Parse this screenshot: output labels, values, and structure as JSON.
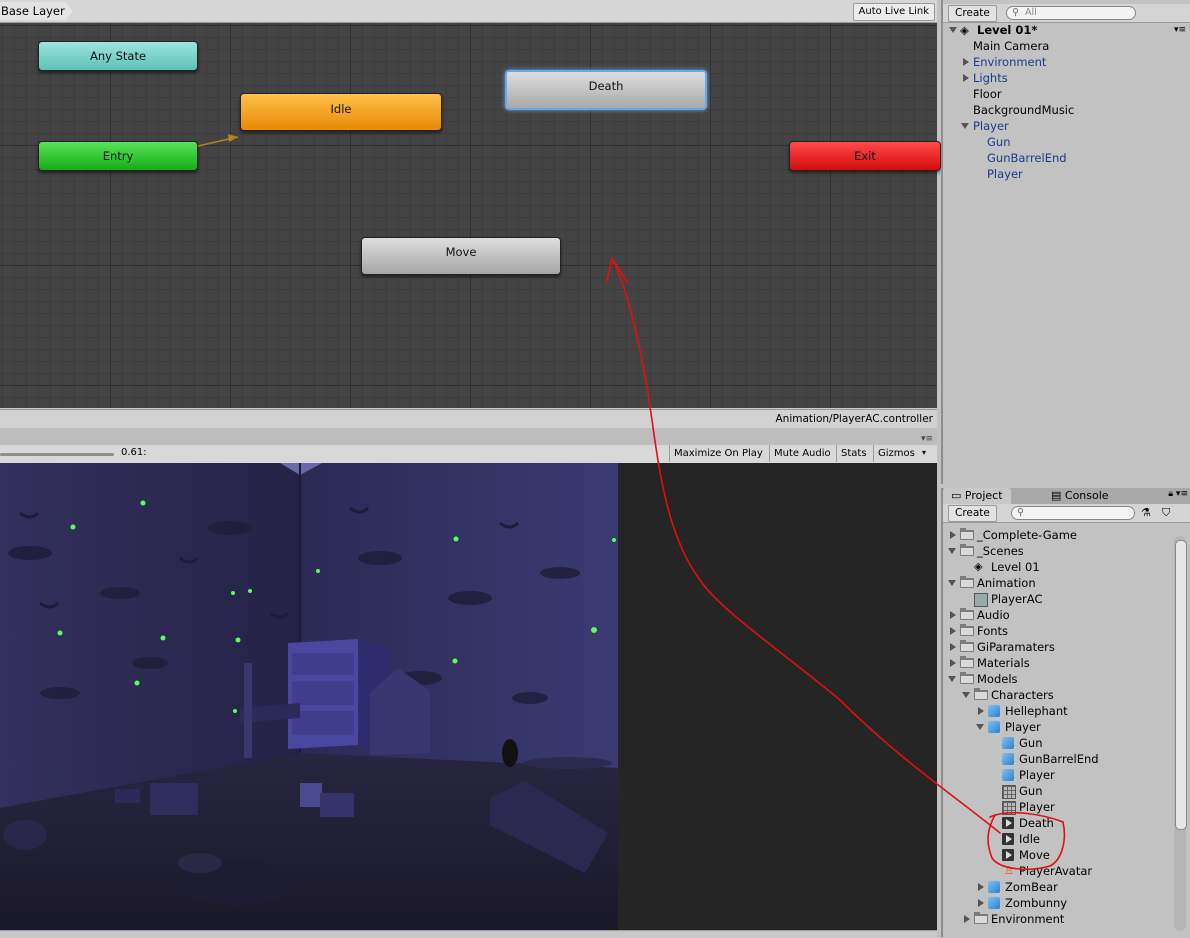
{
  "animator": {
    "breadcrumb": "Base Layer",
    "auto_live_link": "Auto Live Link",
    "controller_path": "Animation/PlayerAC.controller",
    "states": {
      "any_state": "Any State",
      "idle": "Idle",
      "death": "Death",
      "entry": "Entry",
      "exit": "Exit",
      "move": "Move"
    }
  },
  "game_view": {
    "scale_value": "0.61:",
    "maximize_on_play": "Maximize On Play",
    "mute_audio": "Mute Audio",
    "stats": "Stats",
    "gizmos": "Gizmos"
  },
  "hierarchy": {
    "create_label": "Create",
    "search_placeholder": "All",
    "scene_name": "Level 01*",
    "items": [
      {
        "label": "Main Camera"
      },
      {
        "label": "Environment"
      },
      {
        "label": "Lights"
      },
      {
        "label": "Floor"
      },
      {
        "label": "BackgroundMusic"
      },
      {
        "label": "Player"
      },
      {
        "label": "Gun"
      },
      {
        "label": "GunBarrelEnd"
      },
      {
        "label": "Player"
      }
    ]
  },
  "project": {
    "tabs": [
      "Project",
      "Console"
    ],
    "create_label": "Create",
    "tree": [
      {
        "label": "_Complete-Game"
      },
      {
        "label": "_Scenes"
      },
      {
        "label": "Level 01"
      },
      {
        "label": "Animation"
      },
      {
        "label": "PlayerAC"
      },
      {
        "label": "Audio"
      },
      {
        "label": "Fonts"
      },
      {
        "label": "GiParamaters"
      },
      {
        "label": "Materials"
      },
      {
        "label": "Models"
      },
      {
        "label": "Characters"
      },
      {
        "label": "Hellephant"
      },
      {
        "label": "Player"
      },
      {
        "label": "Gun"
      },
      {
        "label": "GunBarrelEnd"
      },
      {
        "label": "Player"
      },
      {
        "label": "Gun"
      },
      {
        "label": "Player"
      },
      {
        "label": "Death"
      },
      {
        "label": "Idle"
      },
      {
        "label": "Move"
      },
      {
        "label": "PlayerAvatar"
      },
      {
        "label": "ZomBear"
      },
      {
        "label": "Zombunny"
      },
      {
        "label": "Environment"
      }
    ]
  },
  "colors": {
    "any_state": "#5dc2b6",
    "idle": "#e88a06",
    "entry": "#15ad15",
    "exit": "#d40c0c",
    "annotation": "#e01010",
    "hierarchy_link": "#1a3b8c"
  }
}
